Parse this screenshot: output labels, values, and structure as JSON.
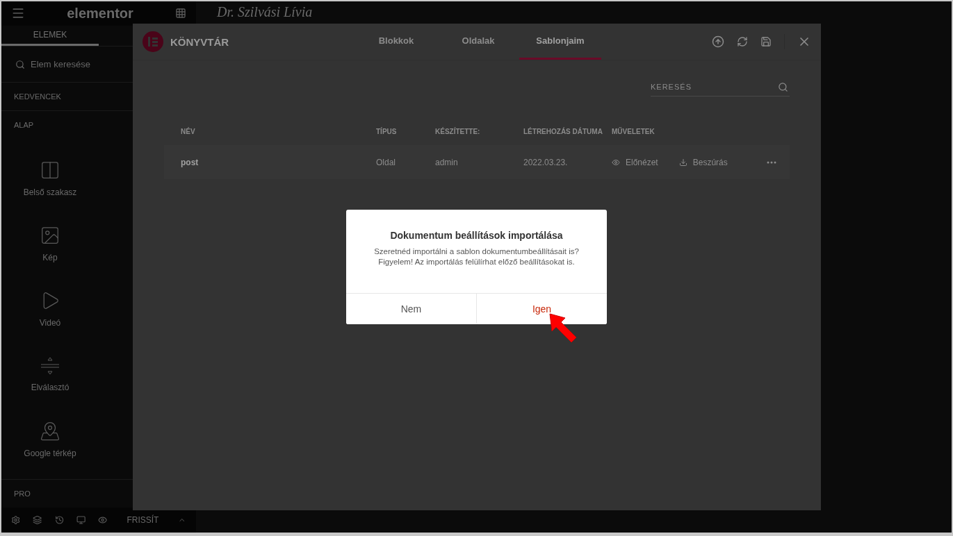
{
  "page_title": "Dr. Szilvási Lívia",
  "sidebar": {
    "logo": "elementor",
    "tabs": [
      {
        "label": "ELEMEK",
        "selected": true
      }
    ],
    "search": {
      "placeholder": "Elem keresése"
    },
    "sections": [
      {
        "title": "KEDVENCEK"
      },
      {
        "title": "ALAP",
        "widgets": [
          "Belső szakasz",
          "Kép",
          "Videó",
          "Elválasztó",
          "Google térkép"
        ]
      },
      {
        "title": "PRO"
      }
    ],
    "footer": {
      "update_button": "FRISSÍT"
    }
  },
  "library": {
    "title": "KÖNYVTÁR",
    "tabs": [
      {
        "label": "Blokkok",
        "selected": false
      },
      {
        "label": "Oldalak",
        "selected": false
      },
      {
        "label": "Sablonjaim",
        "selected": true
      }
    ],
    "search": {
      "placeholder": "KERESÉS"
    },
    "table": {
      "columns": [
        "NÉV",
        "TÍPUS",
        "KÉSZÍTETTE:",
        "LÉTREHOZÁS DÁTUMA",
        "MŰVELETEK"
      ],
      "rows": [
        {
          "name": "post",
          "type": "Oldal",
          "author": "admin",
          "date": "2022.03.23.",
          "preview": "Előnézet",
          "insert": "Beszúrás"
        }
      ]
    }
  },
  "dialog": {
    "title": "Dokumentum beállítások importálása",
    "message": [
      "Szeretnéd importálni a sablon dokumentumbeállításait is?",
      "Figyelem! Az importálás felülírhat előző beállításokat is."
    ],
    "buttons": [
      {
        "label": "Nem",
        "primary": false
      },
      {
        "label": "Igen",
        "primary": true
      }
    ]
  }
}
